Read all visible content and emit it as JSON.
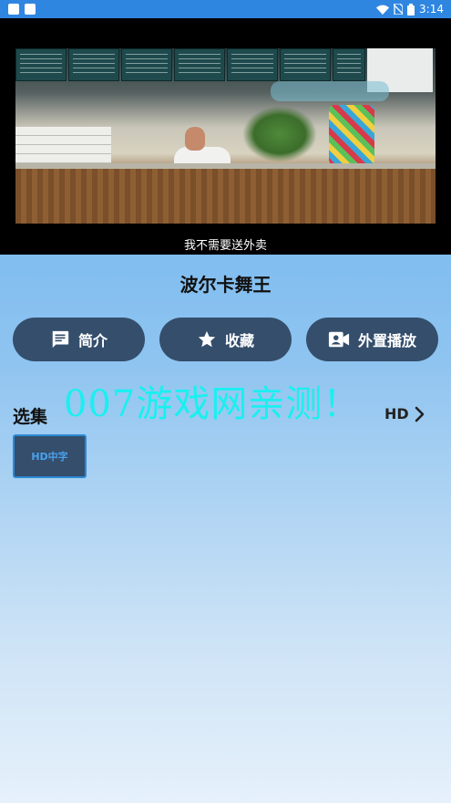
{
  "status_bar": {
    "time": "3:14"
  },
  "video": {
    "subtitle": "我不需要送外卖"
  },
  "movie": {
    "title": "波尔卡舞王"
  },
  "actions": [
    {
      "label": "简介",
      "icon": "comment-icon"
    },
    {
      "label": "收藏",
      "icon": "star-icon"
    },
    {
      "label": "外置播放",
      "icon": "video-account-icon"
    }
  ],
  "episodes": {
    "section_label": "选集",
    "quality": "HD",
    "items": [
      {
        "label": "HD中字"
      }
    ]
  },
  "watermark": {
    "text": "007游戏网亲测！"
  },
  "colors": {
    "status_bar": "#2f86e0",
    "button_bg": "#344e6c",
    "chip_border": "#2b8ad6",
    "watermark": "#19f0f0"
  }
}
